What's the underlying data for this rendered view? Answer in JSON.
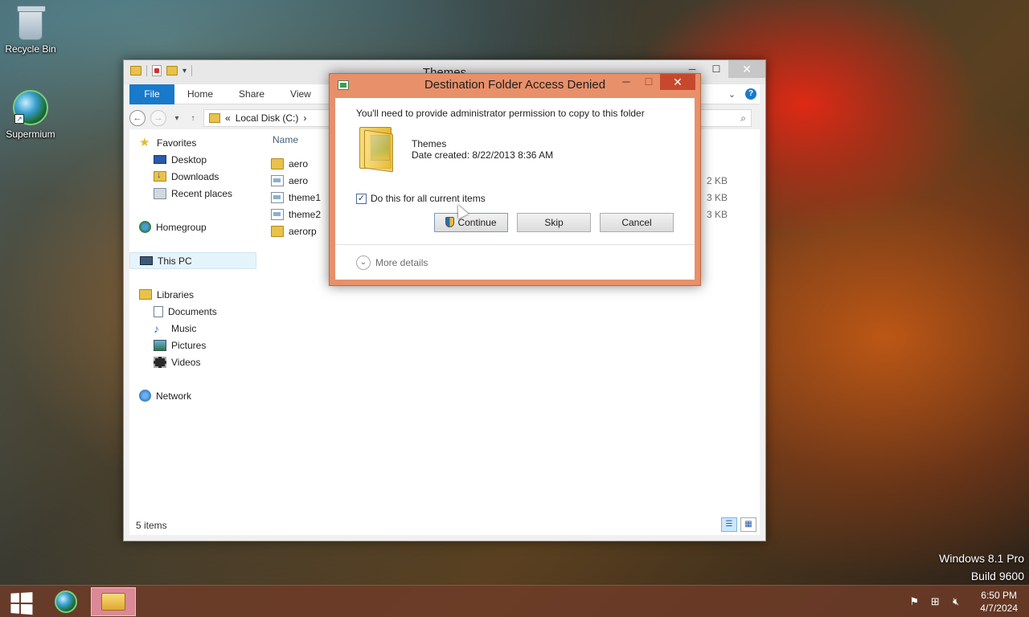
{
  "desktop": {
    "icons": [
      {
        "label": "Recycle Bin"
      },
      {
        "label": "Supermium"
      }
    ]
  },
  "explorer": {
    "title": "Themes",
    "tabs": {
      "file": "File",
      "home": "Home",
      "share": "Share",
      "view": "View"
    },
    "address": {
      "prefix": "«",
      "location": "Local Disk (C:)",
      "sep": "›"
    },
    "nav": {
      "favorites": "Favorites",
      "desktop": "Desktop",
      "downloads": "Downloads",
      "recent": "Recent places",
      "homegroup": "Homegroup",
      "this_pc": "This PC",
      "libraries": "Libraries",
      "documents": "Documents",
      "music": "Music",
      "pictures": "Pictures",
      "videos": "Videos",
      "network": "Network"
    },
    "columns": {
      "name": "Name"
    },
    "files": [
      {
        "name": "aero",
        "type": "folder",
        "size": ""
      },
      {
        "name": "aero",
        "type": "file",
        "size": "2 KB"
      },
      {
        "name": "theme1",
        "type": "file",
        "size": "3 KB"
      },
      {
        "name": "theme2",
        "type": "file",
        "size": "3 KB"
      },
      {
        "name": "aerorp",
        "type": "folder",
        "size": ""
      }
    ],
    "status": "5 items"
  },
  "dialog": {
    "title": "Destination Folder Access Denied",
    "message": "You'll need to provide administrator permission to copy to this folder",
    "folder_name": "Themes",
    "date_created": "Date created: 8/22/2013 8:36 AM",
    "checkbox_label": "Do this for all current items",
    "checkbox_checked": true,
    "buttons": {
      "continue": "Continue",
      "skip": "Skip",
      "cancel": "Cancel"
    },
    "more_details": "More details"
  },
  "watermark": {
    "line1": "Windows 8.1 Pro",
    "line2": "Build 9600"
  },
  "taskbar": {
    "time": "6:50 PM",
    "date": "4/7/2024"
  }
}
